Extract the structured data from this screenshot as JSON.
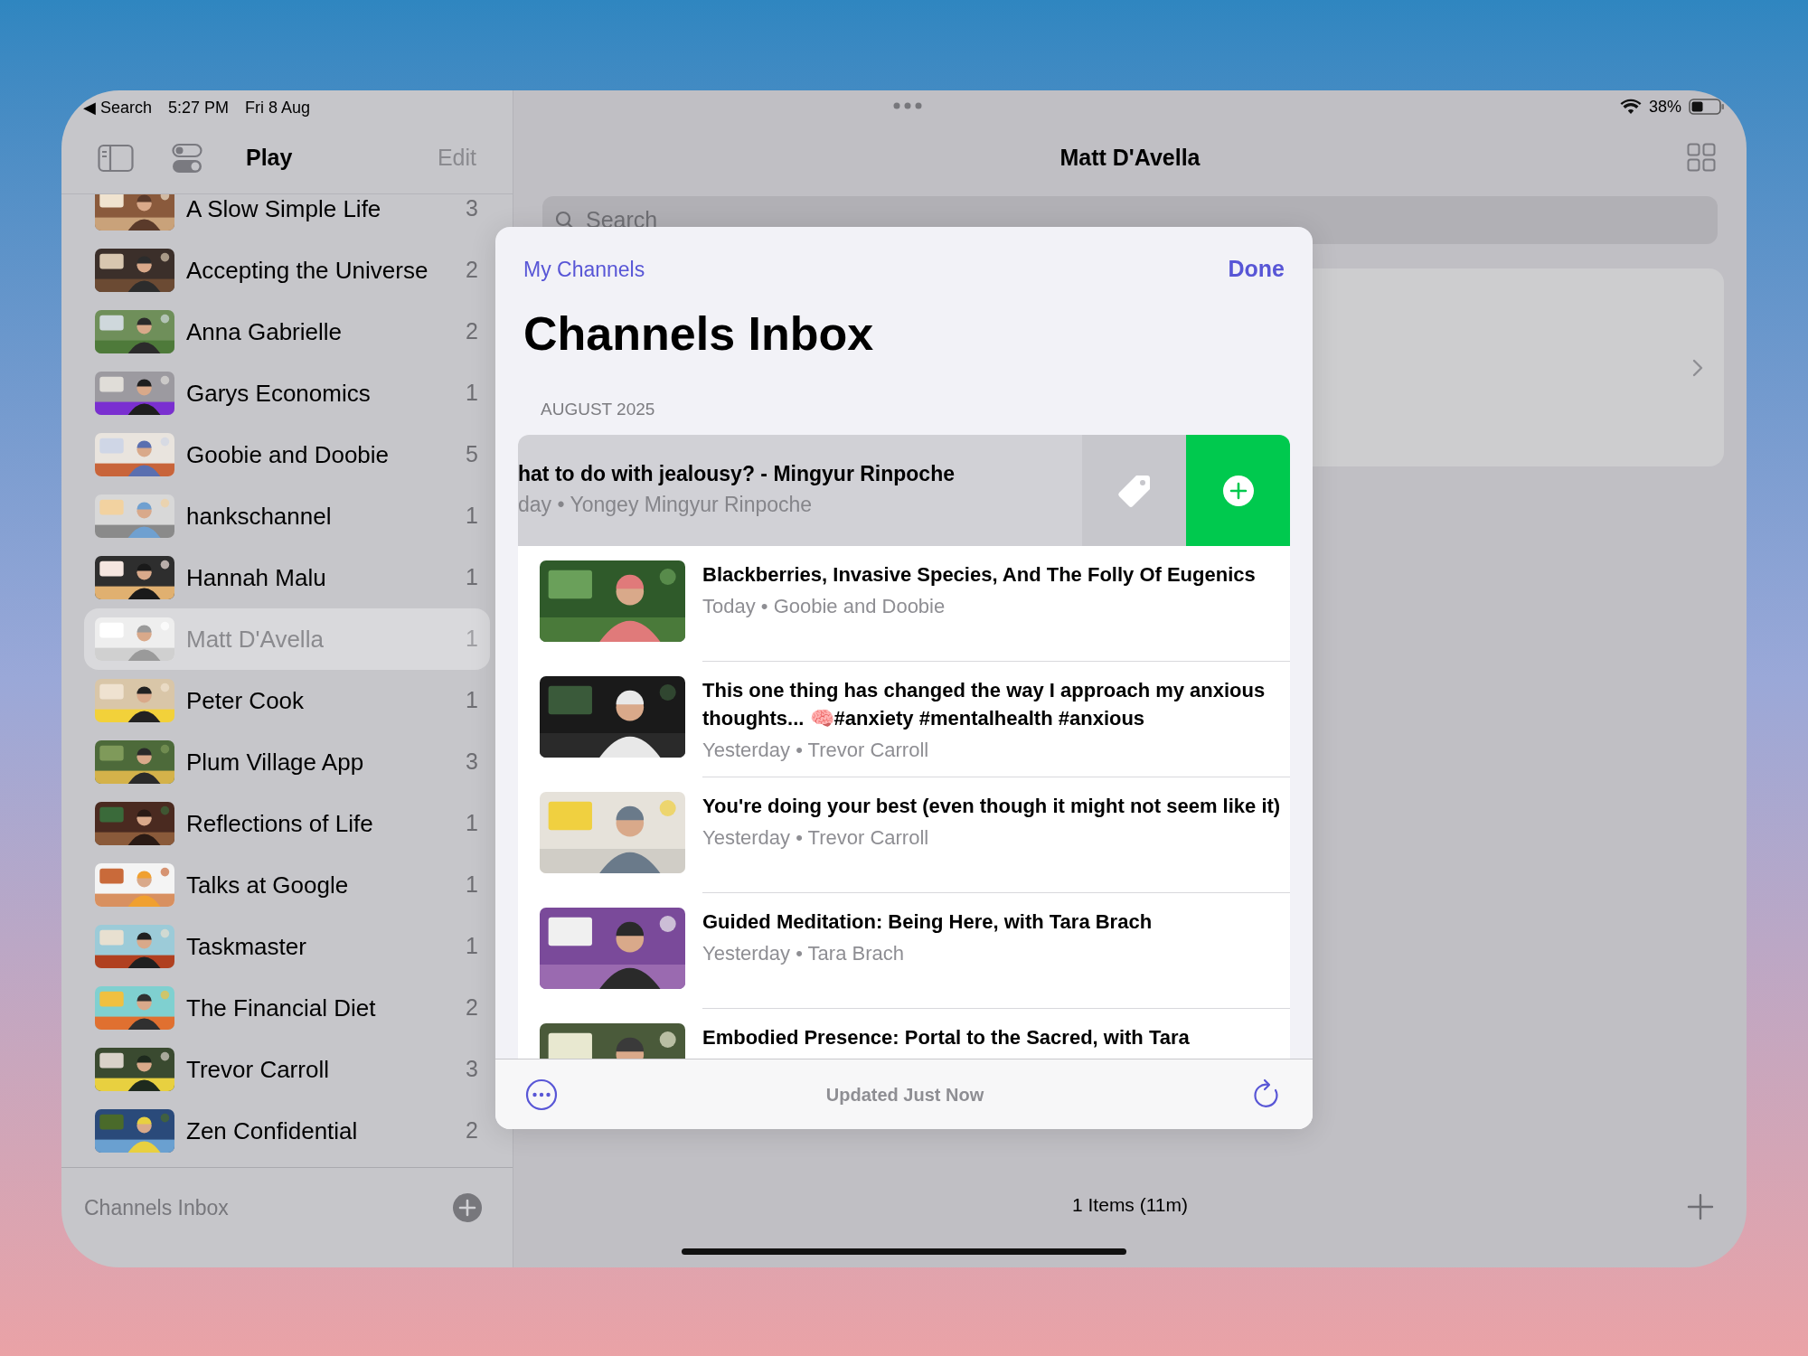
{
  "status_bar": {
    "back": "◀ Search",
    "time": "5:27 PM",
    "date": "Fri 8 Aug",
    "battery": "38%"
  },
  "sidebar": {
    "title": "Play",
    "edit": "Edit",
    "items": [
      {
        "name": "A Slow Simple Life",
        "count": "3",
        "selected": false
      },
      {
        "name": "Accepting the Universe",
        "count": "2",
        "selected": false
      },
      {
        "name": "Anna Gabrielle",
        "count": "2",
        "selected": false
      },
      {
        "name": "Garys Economics",
        "count": "1",
        "selected": false
      },
      {
        "name": "Goobie and Doobie",
        "count": "5",
        "selected": false
      },
      {
        "name": "hankschannel",
        "count": "1",
        "selected": false
      },
      {
        "name": "Hannah Malu",
        "count": "1",
        "selected": false
      },
      {
        "name": "Matt D'Avella",
        "count": "1",
        "selected": true
      },
      {
        "name": "Peter Cook",
        "count": "1",
        "selected": false
      },
      {
        "name": "Plum Village App",
        "count": "3",
        "selected": false
      },
      {
        "name": "Reflections of Life",
        "count": "1",
        "selected": false
      },
      {
        "name": "Talks at Google",
        "count": "1",
        "selected": false
      },
      {
        "name": "Taskmaster",
        "count": "1",
        "selected": false
      },
      {
        "name": "The Financial Diet",
        "count": "2",
        "selected": false
      },
      {
        "name": "Trevor Carroll",
        "count": "3",
        "selected": false
      },
      {
        "name": "Zen Confidential",
        "count": "2",
        "selected": false
      }
    ],
    "footer": {
      "label": "Channels Inbox"
    }
  },
  "main": {
    "title": "Matt D'Avella",
    "search": {
      "placeholder": "Search"
    },
    "summary": "1 Items (11m)"
  },
  "modal": {
    "back": "My Channels",
    "done": "Done",
    "title": "Channels Inbox",
    "section": "AUGUST 2025",
    "rows": [
      {
        "kind": "swiped",
        "title": "hat to do with jealousy? - Mingyur Rinpoche",
        "meta": "day • Yongey Mingyur Rinpoche"
      },
      {
        "kind": "video",
        "title": "Blackberries, Invasive Species, And The Folly Of Eugenics",
        "meta": "Today • Goobie and Doobie"
      },
      {
        "kind": "video",
        "title": "This one thing has changed the way I approach my anxious thoughts... 🧠#anxiety #mentalhealth #anxious",
        "meta": "Yesterday • Trevor Carroll"
      },
      {
        "kind": "video",
        "title": "You're doing your best (even though it might not seem like it)",
        "meta": "Yesterday • Trevor Carroll"
      },
      {
        "kind": "video",
        "title": "Guided Meditation: Being Here, with Tara Brach",
        "meta": "Yesterday • Tara Brach"
      },
      {
        "kind": "video",
        "title": "Embodied Presence: Portal to the Sacred, with Tara"
      }
    ],
    "footer": {
      "status": "Updated Just Now"
    }
  }
}
